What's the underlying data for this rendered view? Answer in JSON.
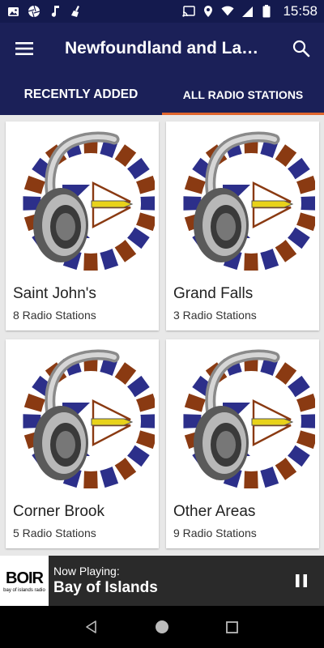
{
  "status_bar": {
    "time": "15:58",
    "left_icons": [
      "image-icon",
      "aperture-icon",
      "music-note-icon",
      "cleaning-broom-icon"
    ],
    "right_icons": [
      "cast-icon",
      "location-icon",
      "wifi-icon",
      "signal-icon",
      "battery-icon"
    ]
  },
  "app_bar": {
    "title": "Newfoundland and Labrador Radio Stations",
    "menu_icon": "hamburger-menu-icon",
    "search_icon": "search-icon"
  },
  "tabs": [
    {
      "label": "RECENTLY ADDED",
      "active": false
    },
    {
      "label": "ALL RADIO STATIONS",
      "active": true
    }
  ],
  "cards": [
    {
      "title": "Saint John's",
      "subtitle": "8 Radio Stations"
    },
    {
      "title": "Grand Falls",
      "subtitle": "3 Radio Stations"
    },
    {
      "title": "Corner Brook",
      "subtitle": "5 Radio Stations"
    },
    {
      "title": "Other Areas",
      "subtitle": "9 Radio Stations"
    }
  ],
  "now_playing": {
    "label": "Now Playing:",
    "station": "Bay of Islands",
    "logo_text": "BOIR",
    "logo_subtext": "bay of islands radio",
    "pause_icon": "pause-icon"
  },
  "nav_bar": {
    "icons": [
      "back-icon",
      "home-icon",
      "recents-icon"
    ]
  },
  "colors": {
    "app_bar": "#1b2058",
    "status_bar": "#141a4e",
    "tab_indicator": "#e0662e",
    "flag_blue": "#2c2f8a",
    "flag_gold": "#e8d21a",
    "flag_red": "#8a3a12"
  }
}
